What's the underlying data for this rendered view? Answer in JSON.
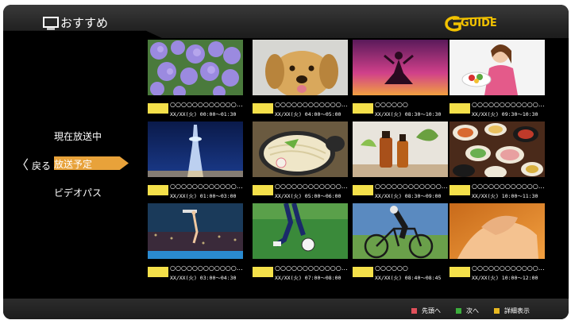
{
  "header": {
    "title": "おすすめ",
    "logo_text": "GUIDE"
  },
  "nav": {
    "back_label": "戻る",
    "items": [
      {
        "label": "現在放送中"
      },
      {
        "label": "放送予定",
        "selected": true
      },
      {
        "label": "ビデオパス"
      }
    ]
  },
  "programs": [
    {
      "title": "○○○○○○○○○○○○…",
      "time": "XX/XX(火) 00:00～01:30",
      "image": "hydrangea-flowers"
    },
    {
      "title": "○○○○○○○○○○○○…",
      "time": "XX/XX(火) 04:00～05:00",
      "image": "puppy"
    },
    {
      "title": "○○○○○○",
      "time": "XX/XX(火) 08:30～10:30",
      "image": "yoga-silhouette"
    },
    {
      "title": "○○○○○○○○○○○○…",
      "time": "XX/XX(火) 09:30～10:30",
      "image": "woman-eating-salad"
    },
    {
      "title": "○○○○○○○○○○○○…",
      "time": "XX/XX(火) 01:00～03:00",
      "image": "tokyo-skytree-night"
    },
    {
      "title": "○○○○○○○○○○○○…",
      "time": "XX/XX(火) 05:00～06:00",
      "image": "udon-noodles"
    },
    {
      "title": "○○○○○○○○○○○○…",
      "time": "XX/XX(火) 08:30～09:00",
      "image": "aroma-oil-bottles"
    },
    {
      "title": "○○○○○○○○○○○○…",
      "time": "XX/XX(火) 10:00～11:30",
      "image": "japanese-dinner-table"
    },
    {
      "title": "○○○○○○○○○○○○…",
      "time": "XX/XX(火) 03:00～04:30",
      "image": "diving-stadium"
    },
    {
      "title": "○○○○○○○○○○○○…",
      "time": "XX/XX(火) 07:00～08:00",
      "image": "soccer-kick"
    },
    {
      "title": "○○○○○○",
      "time": "XX/XX(火) 08:40～08:45",
      "image": "cyclist"
    },
    {
      "title": "○○○○○○○○○○○○…",
      "time": "XX/XX(火) 10:00～12:00",
      "image": "foot-massage"
    }
  ],
  "footer": {
    "actions": [
      {
        "color": "#e0505a",
        "label": "先頭へ"
      },
      {
        "color": "#3cae3c",
        "label": "次へ"
      },
      {
        "color": "#e8b820",
        "label": "詳細表示"
      }
    ]
  },
  "colors": {
    "badge": "#f4e04a",
    "selected": "#e8a23a",
    "background": "#000000"
  }
}
